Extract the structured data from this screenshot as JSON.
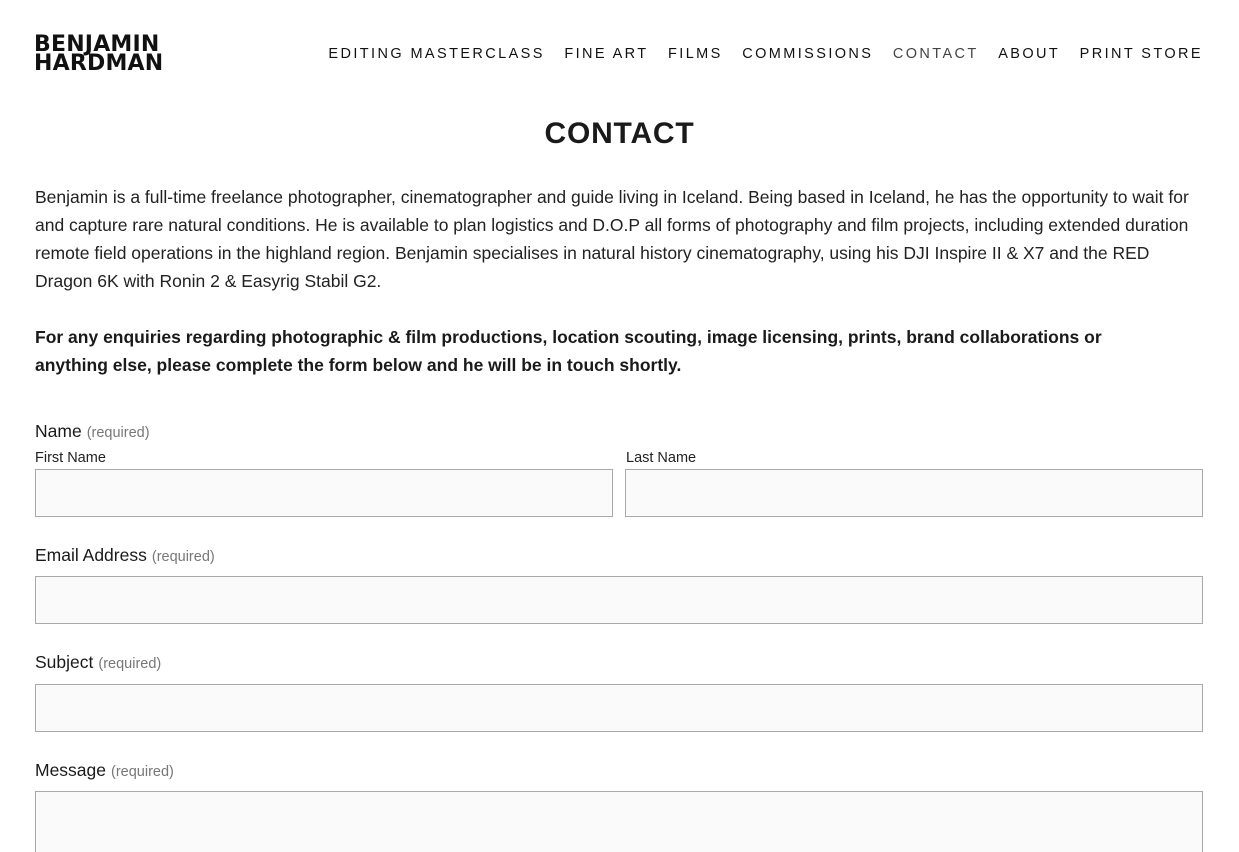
{
  "header": {
    "logo_line1": "BENJAMIN",
    "logo_line2": "HARDMAN",
    "nav": [
      {
        "label": "EDITING MASTERCLASS",
        "active": false
      },
      {
        "label": "FINE ART",
        "active": false
      },
      {
        "label": "FILMS",
        "active": false
      },
      {
        "label": "COMMISSIONS",
        "active": false
      },
      {
        "label": "CONTACT",
        "active": true
      },
      {
        "label": "ABOUT",
        "active": false
      },
      {
        "label": "PRINT STORE",
        "active": false
      }
    ]
  },
  "main": {
    "title": "CONTACT",
    "intro": "Benjamin is a full-time freelance photographer, cinematographer and guide living in Iceland. Being based in Iceland, he has the opportunity to wait for and capture rare natural conditions. He is available to plan logistics and D.O.P all forms of photography and film projects, including extended duration remote field operations in the highland region. Benjamin specialises in natural history cinematography, using his DJI Inspire II & X7 and the RED Dragon 6K with Ronin 2 & Easyrig Stabil G2.",
    "intro_bold": "For any enquiries regarding photographic & film productions, location scouting, image licensing, prints, brand collaborations or anything else, please complete the form below and he will be in touch shortly."
  },
  "form": {
    "required_text": "(required)",
    "name": {
      "label": "Name",
      "first_label": "First Name",
      "first_value": "",
      "last_label": "Last Name",
      "last_value": ""
    },
    "email": {
      "label": "Email Address",
      "value": ""
    },
    "subject": {
      "label": "Subject",
      "value": ""
    },
    "message": {
      "label": "Message",
      "value": ""
    }
  }
}
